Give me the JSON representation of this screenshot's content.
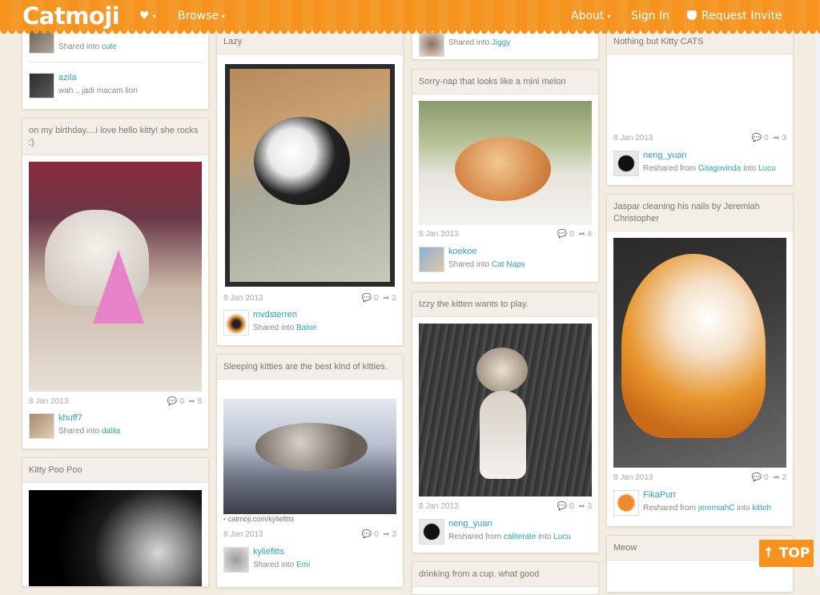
{
  "topbar": {
    "logo": "Catmoji",
    "heart_caret": "▾",
    "browse": "Browse",
    "about": "About",
    "sign_in": "Sign In",
    "request_invite": "Request Invite"
  },
  "columns": {
    "c1": {
      "top_share_into": "cute",
      "azila": {
        "name": "azila",
        "comment": "wah .. jadi macam lion"
      },
      "birthday": {
        "title": "on my birthday....i love hello kitty! she rocks :)",
        "date": "8 Jan 2013",
        "comments": "0",
        "reshares": "8",
        "user": "khuff7",
        "into": "dalila"
      },
      "poo": {
        "title": "Kitty Poo Poo"
      }
    },
    "c2": {
      "lazy": {
        "title": "Lazy",
        "date": "8 Jan 2013",
        "comments": "0",
        "reshares": "2",
        "user": "mvdsterren",
        "into": "Baloe"
      },
      "sleeping": {
        "title": "Sleeping kitties are the best kind of kitties.",
        "source": "catmoji.com/kyliefitts",
        "date": "8 Jan 2013",
        "comments": "0",
        "reshares": "3",
        "user": "kyliefitts",
        "into": "Emi"
      }
    },
    "c3": {
      "jiggy": {
        "into": "Jiggy"
      },
      "melon": {
        "title": "Sorry-nap that looks like a mini melon",
        "date": "8 Jan 2013",
        "comments": "0",
        "reshares": "4",
        "user": "koekoe",
        "into": "Cat Naps"
      },
      "izzy": {
        "title": "Izzy the kitten wants to play.",
        "date": "8 Jan 2013",
        "comments": "0",
        "reshares": "3",
        "user": "neng_yuan",
        "from": "caliterate",
        "into": "Lucu"
      },
      "drinking": {
        "title": "drinking from a cup. what good"
      }
    },
    "c4": {
      "nothing": {
        "title": "Nothing but Kitty CATS",
        "date": "8 Jan 2013",
        "comments": "0",
        "reshares": "3",
        "user": "neng_yuan",
        "from": "Gitagovinda",
        "into": "Lucu"
      },
      "jaspar": {
        "title": "Jaspar cleaning his nails by Jeremiah Christopher",
        "date": "8 Jan 2013",
        "comments": "0",
        "reshares": "2",
        "user": "FikaPurr",
        "from": "jeremiahC",
        "into": "kitteh"
      },
      "meow": {
        "title": "Meow"
      }
    }
  },
  "labels": {
    "shared_into": "Shared into ",
    "reshared_from": "Reshared from ",
    "into": " into "
  },
  "top_button": "TOP",
  "colors": {
    "brand": "#f6931e",
    "link": "#2aa4b8"
  }
}
